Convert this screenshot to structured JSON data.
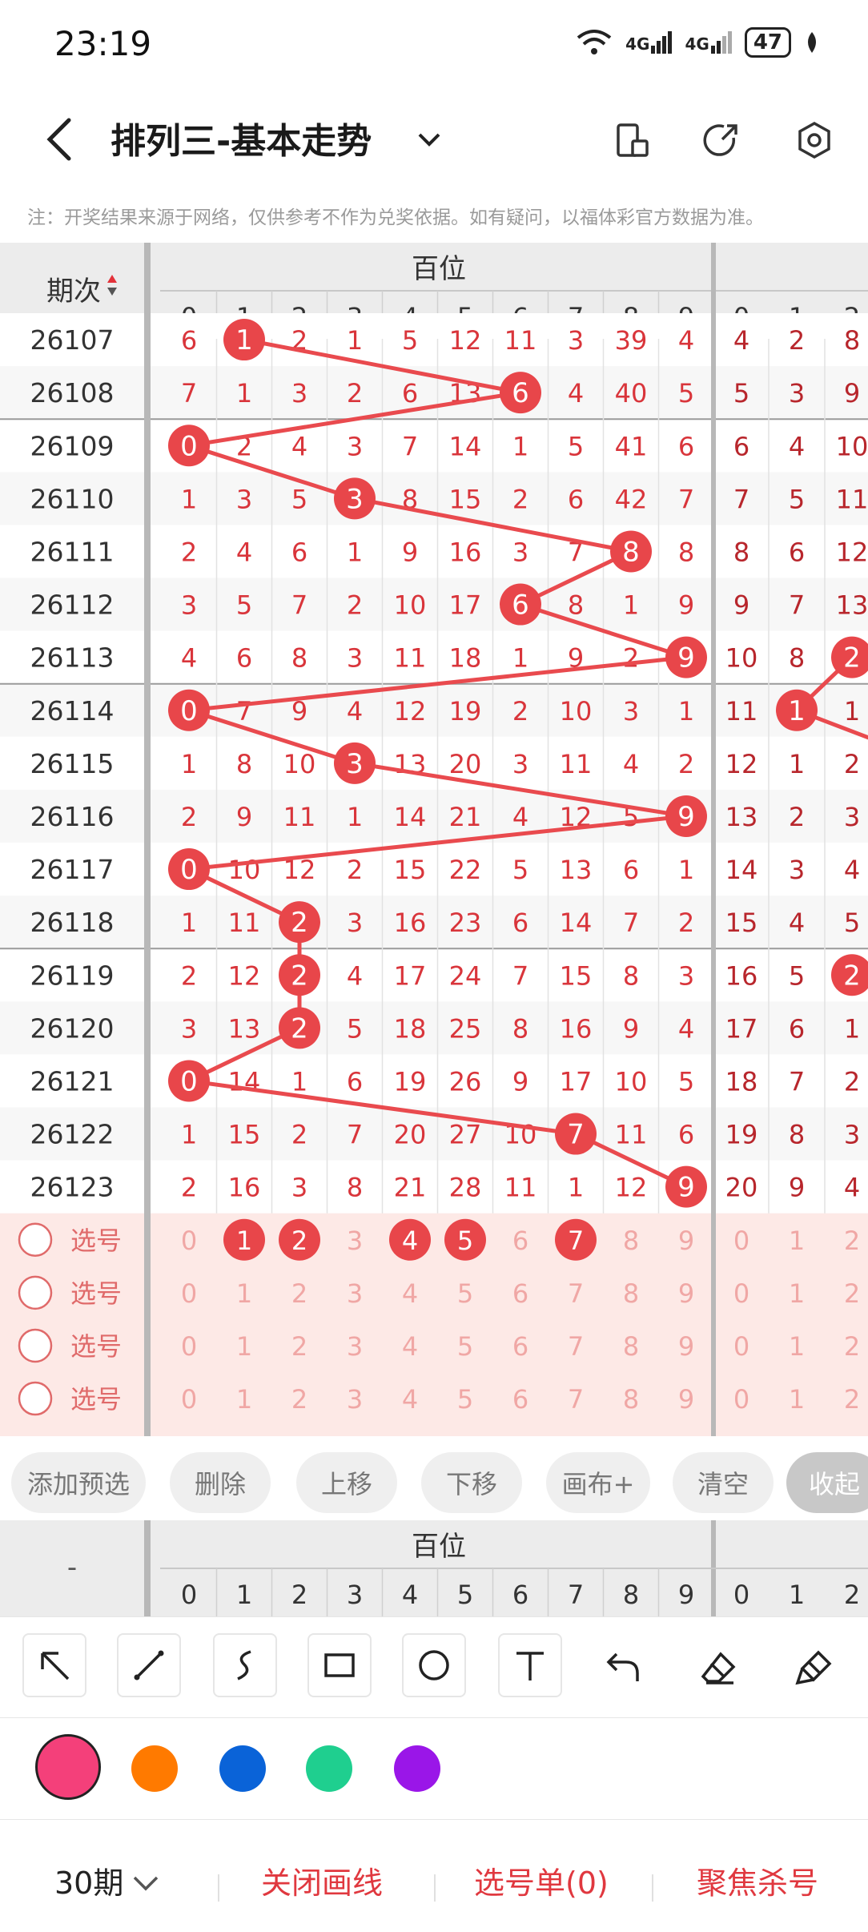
{
  "status_bar": {
    "time": "23:19",
    "battery": "47",
    "net1": "4G",
    "net2": "4G"
  },
  "header": {
    "title": "排列三-基本走势"
  },
  "notice": "注：开奖结果来源于网络，仅供参考不作为兑奖依据。如有疑问，以福体彩官方数据为准。",
  "table": {
    "period_header": "期次",
    "group_label": "百位",
    "digits": [
      "0",
      "1",
      "2",
      "3",
      "4",
      "5",
      "6",
      "7",
      "8",
      "9"
    ],
    "next_digits": [
      "0",
      "1",
      "2"
    ],
    "periods": [
      "26107",
      "26108",
      "26109",
      "26110",
      "26111",
      "26112",
      "26113",
      "26114",
      "26115",
      "26116",
      "26117",
      "26118",
      "26119",
      "26120",
      "26121",
      "26122",
      "26123"
    ],
    "hundreds": [
      1,
      6,
      0,
      3,
      8,
      6,
      9,
      0,
      3,
      9,
      0,
      2,
      2,
      2,
      0,
      7,
      9
    ],
    "rows": [
      [
        "6",
        "1",
        "2",
        "1",
        "5",
        "12",
        "11",
        "3",
        "39",
        "4",
        "4",
        "2",
        "8"
      ],
      [
        "7",
        "1",
        "3",
        "2",
        "6",
        "13",
        "6",
        "4",
        "40",
        "5",
        "5",
        "3",
        "9"
      ],
      [
        "0",
        "2",
        "4",
        "3",
        "7",
        "14",
        "1",
        "5",
        "41",
        "6",
        "6",
        "4",
        "10"
      ],
      [
        "1",
        "3",
        "5",
        "3",
        "8",
        "15",
        "2",
        "6",
        "42",
        "7",
        "7",
        "5",
        "11"
      ],
      [
        "2",
        "4",
        "6",
        "1",
        "9",
        "16",
        "3",
        "7",
        "8",
        "8",
        "8",
        "6",
        "12"
      ],
      [
        "3",
        "5",
        "7",
        "2",
        "10",
        "17",
        "6",
        "8",
        "1",
        "9",
        "9",
        "7",
        "13"
      ],
      [
        "4",
        "6",
        "8",
        "3",
        "11",
        "18",
        "1",
        "9",
        "2",
        "9",
        "10",
        "8",
        "2"
      ],
      [
        "0",
        "7",
        "9",
        "4",
        "12",
        "19",
        "2",
        "10",
        "3",
        "1",
        "11",
        "1",
        "1"
      ],
      [
        "1",
        "8",
        "10",
        "3",
        "13",
        "20",
        "3",
        "11",
        "4",
        "2",
        "12",
        "1",
        "2"
      ],
      [
        "2",
        "9",
        "11",
        "1",
        "14",
        "21",
        "4",
        "12",
        "5",
        "9",
        "13",
        "2",
        "3"
      ],
      [
        "0",
        "10",
        "12",
        "2",
        "15",
        "22",
        "5",
        "13",
        "6",
        "1",
        "14",
        "3",
        "4"
      ],
      [
        "1",
        "11",
        "2",
        "3",
        "16",
        "23",
        "6",
        "14",
        "7",
        "2",
        "15",
        "4",
        "5"
      ],
      [
        "2",
        "12",
        "2",
        "4",
        "17",
        "24",
        "7",
        "15",
        "8",
        "3",
        "16",
        "5",
        "2"
      ],
      [
        "3",
        "13",
        "2",
        "5",
        "18",
        "25",
        "8",
        "16",
        "9",
        "4",
        "17",
        "6",
        "1"
      ],
      [
        "0",
        "14",
        "1",
        "6",
        "19",
        "26",
        "9",
        "17",
        "10",
        "5",
        "18",
        "7",
        "2"
      ],
      [
        "1",
        "15",
        "2",
        "7",
        "20",
        "27",
        "10",
        "7",
        "11",
        "6",
        "19",
        "8",
        "3"
      ],
      [
        "2",
        "16",
        "3",
        "8",
        "21",
        "28",
        "11",
        "1",
        "12",
        "9",
        "20",
        "9",
        "4"
      ]
    ],
    "tens_hits": [
      null,
      null,
      null,
      null,
      null,
      null,
      2,
      1,
      null,
      null,
      null,
      null,
      2,
      null,
      null,
      null,
      null
    ],
    "pick_label": "选号",
    "pick_rows": 4,
    "pick_selected": [
      1,
      2,
      4,
      5,
      7
    ]
  },
  "toolbar": {
    "add": "添加预选",
    "delete": "删除",
    "up": "上移",
    "down": "下移",
    "canvas": "画布+",
    "clear": "清空",
    "collapse": "收起"
  },
  "header2": {
    "period": "-",
    "group_label": "百位"
  },
  "draw_tools": [
    "arrow-icon",
    "line-icon",
    "curve-icon",
    "rect-icon",
    "circle-icon",
    "text-icon",
    "undo-icon",
    "eraser-icon",
    "clear-brush-icon"
  ],
  "colors": [
    "#f4407a",
    "#ff7a00",
    "#0a63d8",
    "#1fcf8f",
    "#9a16e8"
  ],
  "bottom": {
    "periods": "30期",
    "close_line": "关闭画线",
    "pick_list": "选号单(0)",
    "focus_kill": "聚焦杀号"
  }
}
